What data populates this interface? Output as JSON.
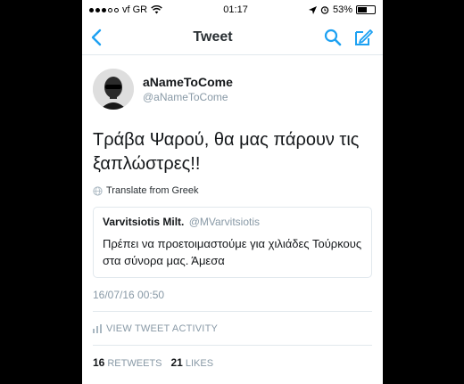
{
  "status_bar": {
    "carrier": "vf GR",
    "time": "01:17",
    "battery": "53%",
    "signal_bars": 3,
    "battery_level": 0.53
  },
  "navbar": {
    "title": "Tweet",
    "back_icon": "chevron-left-icon",
    "search_icon": "search-icon",
    "compose_icon": "compose-icon",
    "accent": "#1da1f2"
  },
  "tweet": {
    "author_name": "aNameToCome",
    "author_handle": "@aNameToCome",
    "text": "Τράβα Ψαρού, θα μας πάρουν τις ξαπλώστρες!!",
    "translate_label": "Translate from Greek",
    "quoted": {
      "name": "Varvitsiotis Milt.",
      "handle": "@MVarvitsiotis",
      "text": "Πρέπει να προετοιμαστούμε για χιλιάδες Τούρκους στα σύνορα μας. Άμεσα"
    },
    "timestamp": "16/07/16 00:50",
    "activity_label": "VIEW TWEET ACTIVITY",
    "retweets_count": "16",
    "retweets_label": "RETWEETS",
    "likes_count": "21",
    "likes_label": "LIKES"
  }
}
